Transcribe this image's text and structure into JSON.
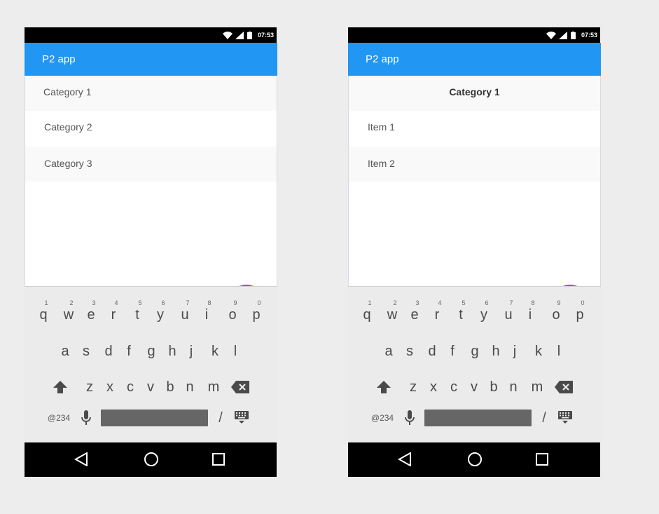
{
  "left": {
    "status": {
      "time": "07:53"
    },
    "app_title": "P2 app",
    "rows": [
      "Category 1",
      "Category 2",
      "Category 3"
    ]
  },
  "right": {
    "status": {
      "time": "07:53"
    },
    "app_title": "P2 app",
    "header": "Category 1",
    "rows": [
      "Item 1",
      "Item 2"
    ]
  },
  "keyboard": {
    "row1_hints": [
      "1",
      "2",
      "3",
      "4",
      "5",
      "6",
      "7",
      "8",
      "9",
      "0"
    ],
    "row1_keys": [
      "q",
      "w",
      "e",
      "r",
      "t",
      "y",
      "u",
      "i",
      "o",
      "p"
    ],
    "row2_keys": [
      "a",
      "s",
      "d",
      "f",
      "g",
      "h",
      "j",
      "k",
      "l"
    ],
    "row3_keys": [
      "z",
      "x",
      "c",
      "v",
      "b",
      "n",
      "m"
    ],
    "symbols_label": "@234",
    "slash_label": "/"
  },
  "colors": {
    "app_bar": "#2196f3",
    "fab": "#8a4fe8",
    "keyboard_bg": "#ebebeb",
    "nav_bar": "#000000"
  },
  "icons": {
    "status": [
      "wifi-icon",
      "signal-icon",
      "battery-icon"
    ],
    "fab": "plus-icon",
    "keyboard": [
      "shift-icon",
      "backspace-icon",
      "mic-icon",
      "keyboard-settings-icon"
    ],
    "nav": [
      "back-icon",
      "home-icon",
      "recents-icon"
    ]
  }
}
